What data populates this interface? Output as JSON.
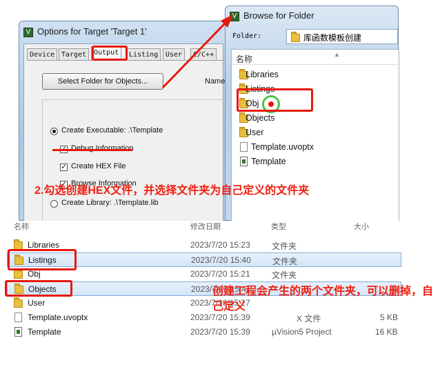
{
  "options_dialog": {
    "title": "Options for Target 'Target 1'",
    "tabs": [
      "Device",
      "Target",
      "Output",
      "Listing",
      "User",
      "C/C++"
    ],
    "active_tab": "Output",
    "select_folder_button": "Select Folder for Objects...",
    "name_label": "Name",
    "create_executable": "Create Executable:  .\\Template",
    "debug_info": "Debug Information",
    "create_hex": "Create HEX File",
    "browse_info": "Browse Information",
    "create_library": "Create Library:  .\\Template.lib"
  },
  "browse_dialog": {
    "title": "Browse for Folder",
    "folder_label": "Folder:",
    "folder_value": "库函数模板创建",
    "column_header": "名称",
    "items": [
      {
        "name": "Libraries",
        "icon": "folder-icon"
      },
      {
        "name": "Listings",
        "icon": "folder-icon"
      },
      {
        "name": "Obj",
        "icon": "folder-icon"
      },
      {
        "name": "Objects",
        "icon": "folder-icon"
      },
      {
        "name": "User",
        "icon": "folder-icon"
      },
      {
        "name": "Template.uvoptx",
        "icon": "file-icon"
      },
      {
        "name": "Template",
        "icon": "project-icon"
      }
    ]
  },
  "explorer": {
    "headers": {
      "name": "名称",
      "date": "修改日期",
      "type": "类型",
      "size": "大小"
    },
    "rows": [
      {
        "name": "Libraries",
        "date": "2023/7/20 15:23",
        "type": "文件夹",
        "size": "",
        "icon": "folder-icon"
      },
      {
        "name": "Listings",
        "date": "2023/7/20 15:40",
        "type": "文件夹",
        "size": "",
        "icon": "folder-icon"
      },
      {
        "name": "Obj",
        "date": "2023/7/20 15:21",
        "type": "文件夹",
        "size": "",
        "icon": "folder-icon"
      },
      {
        "name": "Objects",
        "date": "2023/7/20 15:4",
        "type": "",
        "size": "",
        "icon": "folder-icon"
      },
      {
        "name": "User",
        "date": "2023/7/20 15:27",
        "type": "",
        "size": "",
        "icon": "folder-icon"
      },
      {
        "name": "Template.uvoptx",
        "date": "2023/7/20 15:39",
        "type": "X 文件",
        "size": "5 KB",
        "icon": "file-icon"
      },
      {
        "name": "Template",
        "date": "2023/7/20 15:39",
        "type": "µVision5 Project",
        "size": "16 KB",
        "icon": "project-icon"
      }
    ]
  },
  "annotations": {
    "note1": "2.勾选创建HEX文件，并选择文件夹为自己定义的文件夹",
    "note2": "创建工程会产生的两个文件夹，可以删掉，自己定义"
  },
  "colors": {
    "annotation_red": "#e8170c",
    "selection_blue": "#d2e4f7"
  }
}
